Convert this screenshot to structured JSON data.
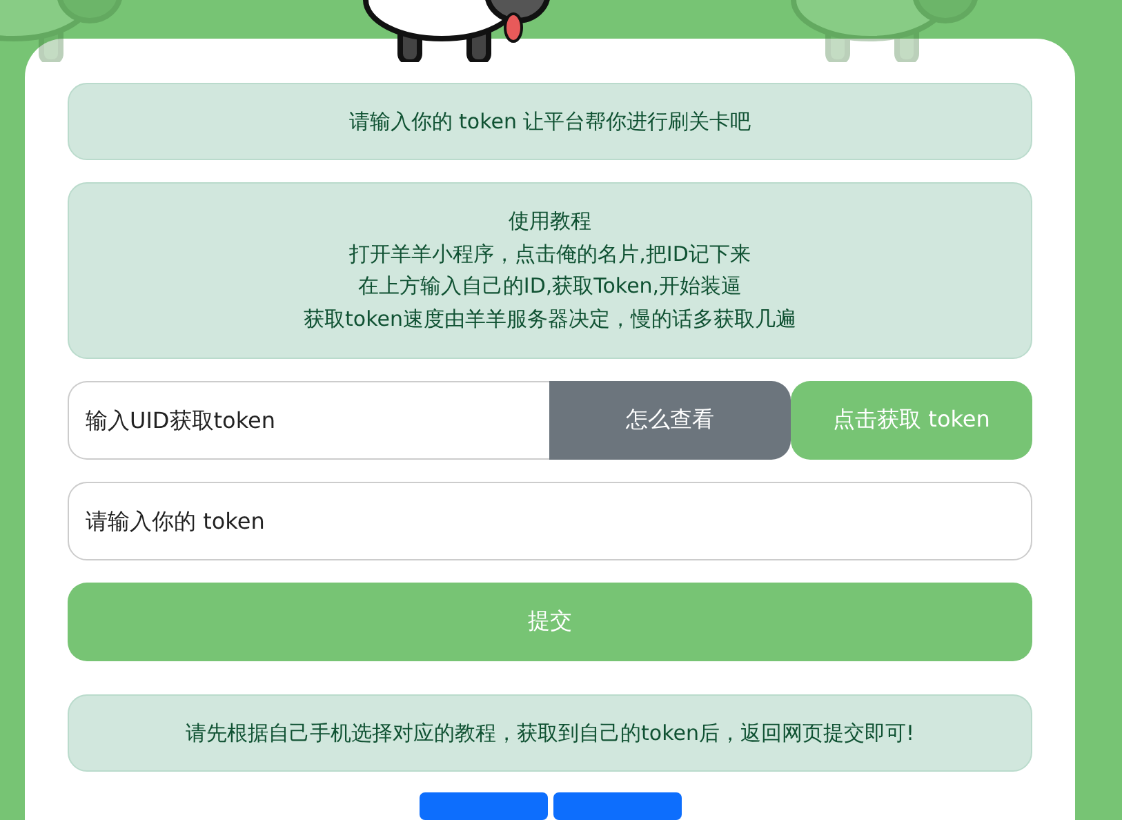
{
  "intro_notice": {
    "text": "请输入你的 token 让平台帮你进行刷关卡吧"
  },
  "tutorial": {
    "title": "使用教程",
    "lines": [
      "打开羊羊小程序，点击俺的名片,把ID记下来",
      "在上方输入自己的ID,获取Token,开始装逼",
      "获取token速度由羊羊服务器决定，慢的话多获取几遍"
    ]
  },
  "uid_row": {
    "field": {
      "placeholder": "输入UID获取token"
    },
    "help_button": "怎么查看",
    "fetch_button": "点击获取 token"
  },
  "token_field": {
    "placeholder": "请输入你的 token"
  },
  "submit_button": "提交",
  "footer_notice": {
    "text": "请先根据自己手机选择对应的教程，获取到自己的token后，返回网页提交即可!"
  },
  "bottom_buttons": [
    {
      "kind": "primary"
    },
    {
      "kind": "primary"
    }
  ]
}
